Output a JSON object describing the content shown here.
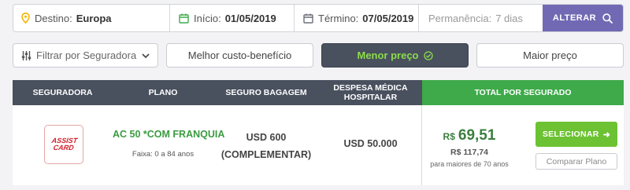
{
  "search": {
    "destination": {
      "label": "Destino:",
      "value": "Europa",
      "icon": "map-pin-icon"
    },
    "start": {
      "label": "Início:",
      "value": "01/05/2019",
      "icon": "calendar-icon"
    },
    "end": {
      "label": "Término:",
      "value": "07/05/2019",
      "icon": "calendar-icon"
    },
    "stay": {
      "label": "Permanência:",
      "value": "7 dias"
    },
    "button": {
      "label": "ALTERAR",
      "icon": "search-icon"
    }
  },
  "filters": {
    "insurer_select": {
      "label": "Filtrar por Seguradora",
      "icon": "sliders-icon"
    },
    "best_value": "Melhor custo-benefício",
    "lowest_price": "Menor preço",
    "highest_price": "Maior preço"
  },
  "table": {
    "headers": {
      "insurer": "SEGURADORA",
      "plan": "PLANO",
      "baggage": "SEGURO BAGAGEM",
      "medical": "DESPESA MÉDICA HOSPITALAR",
      "total": "TOTAL POR SEGURADO"
    },
    "rows": [
      {
        "insurer_logo_text": "ASSIST CARD",
        "plan_name": "AC 50 *COM FRANQUIA",
        "age_range": "Faixa: 0 a 84 anos",
        "baggage_line1": "USD 600",
        "baggage_line2": "(COMPLEMENTAR)",
        "medical": "USD 50.000",
        "price_currency": "R$",
        "price_value": "69,51",
        "price_senior": "R$ 117,74",
        "price_senior_note": "para maiores de 70 anos",
        "select_label": "SELECIONAR",
        "compare_label": "Comparar Plano"
      }
    ]
  },
  "colors": {
    "accent_purple": "#7169b3",
    "header_dark": "#49505e",
    "header_green": "#3eaa4a",
    "select_green": "#6cc232",
    "active_text_green": "#8bdc4a",
    "logo_red": "#d0202c"
  }
}
